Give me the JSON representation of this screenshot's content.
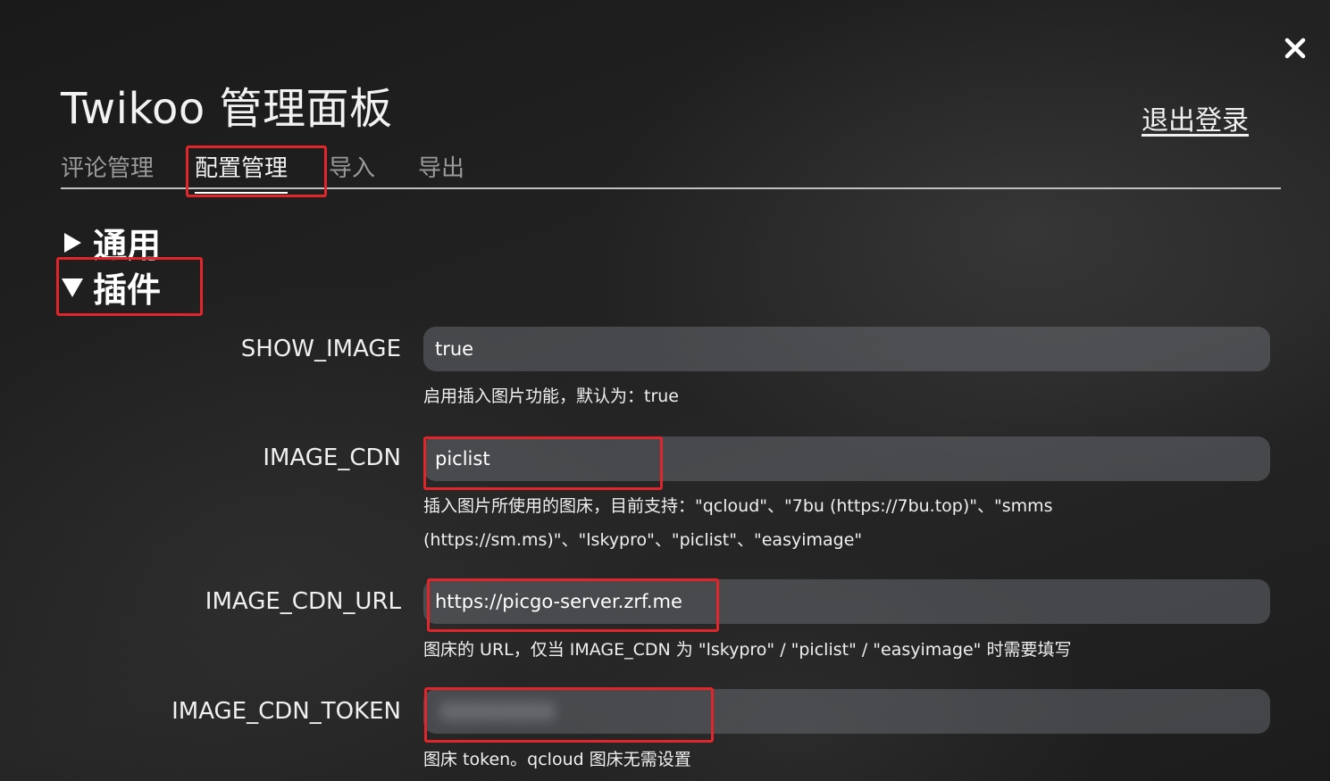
{
  "header": {
    "title": "Twikoo 管理面板",
    "logout_label": "退出登录"
  },
  "tabs": [
    {
      "label": "评论管理",
      "active": false
    },
    {
      "label": "配置管理",
      "active": true
    },
    {
      "label": "导入",
      "active": false
    },
    {
      "label": "导出",
      "active": false
    }
  ],
  "sections": [
    {
      "label": "通用",
      "expanded": false
    },
    {
      "label": "插件",
      "expanded": true
    }
  ],
  "fields": [
    {
      "label": "SHOW_IMAGE",
      "value": "true",
      "help": "启用插入图片功能，默认为：true"
    },
    {
      "label": "IMAGE_CDN",
      "value": "piclist",
      "help": "插入图片所使用的图床，目前支持：\"qcloud\"、\"7bu (https://7bu.top)\"、\"smms (https://sm.ms)\"、\"lskypro\"、\"piclist\"、\"easyimage\""
    },
    {
      "label": "IMAGE_CDN_URL",
      "value": "https://picgo-server.zrf.me",
      "help": "图床的 URL，仅当 IMAGE_CDN 为 \"lskypro\" / \"piclist\" / \"easyimage\" 时需要填写"
    },
    {
      "label": "IMAGE_CDN_TOKEN",
      "value": "",
      "help": "图床 token。qcloud 图床无需设置"
    }
  ],
  "colors": {
    "highlight": "#e0252b",
    "field_bg": "#5a5d63",
    "active_tab": "#f2f2f2",
    "inactive_tab": "#9a9a9a"
  },
  "icons": {
    "close": "close-icon",
    "collapsed": "triangle-right-icon",
    "expanded": "triangle-down-icon"
  }
}
